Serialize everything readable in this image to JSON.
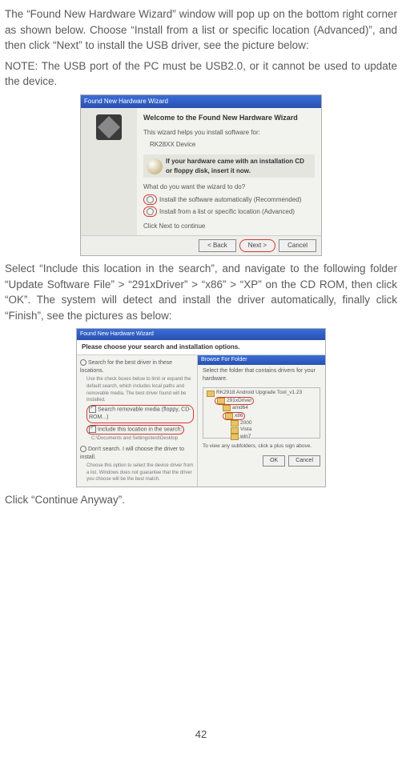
{
  "para1": "The “Found New Hardware Wizard” window will pop up on the bottom right corner as shown below. Choose “Install from a list or specific location (Advanced)”, and then click “Next” to install the USB driver, see the picture below:",
  "para2": "NOTE: The USB port of the PC must be USB2.0, or it cannot be used to update the device.",
  "para3": "Select “Include this location in the search”, and navigate to the following folder “Update Software File” > “291xDriver” > “x86” > “XP” on the CD ROM, then click “OK”. The system will detect and install the driver automatically, finally click “Finish”, see the pictures as below:",
  "para4": "Click “Continue Anyway”.",
  "page_number": "42",
  "fig1": {
    "title": "Found New Hardware Wizard",
    "hdr": "Welcome to the Found New Hardware Wizard",
    "l1": "This wizard helps you install software for:",
    "l2": "RK28XX Device",
    "gray": "If your hardware came with an installation CD or floppy disk, insert it now.",
    "q": "What do you want the wizard to do?",
    "opt1": "Install the software automatically (Recommended)",
    "opt2": "Install from a list or specific location (Advanced)",
    "l3": "Click Next to continue",
    "back": "< Back",
    "next": "Next >",
    "cancel": "Cancel"
  },
  "fig2": {
    "title": "Found New Hardware Wizard",
    "sub": "Please choose your search and installation options.",
    "opt1": "Search for the best driver in these locations.",
    "sm1": "Use the check boxes below to limit or expand the default search, which includes local paths and removable media. The best driver found will be installed.",
    "chk1": "Search removable media (floppy, CD-ROM...)",
    "chk2": "Include this location in the search:",
    "path": "C:\\Documents and Settings\\test\\Desktop",
    "opt2": "Don't search. I will choose the driver to install.",
    "sm2": "Choose this option to select the device driver from a list. Windows does not guarantee that the driver you choose will be the best match.",
    "browse_title": "Browse For Folder",
    "browse_txt": "Select the folder that contains drivers for your hardware.",
    "tree_root": "RK2918 Android Upgrade Tool_v1.23",
    "tree_1": "291xDriver",
    "tree_2": "amd64",
    "tree_3": "x86",
    "tree_4": "2000",
    "tree_5": "Vista",
    "tree_6": "win7",
    "hint": "To view any subfolders, click a plus sign above.",
    "ok": "OK",
    "cancel": "Cancel"
  }
}
